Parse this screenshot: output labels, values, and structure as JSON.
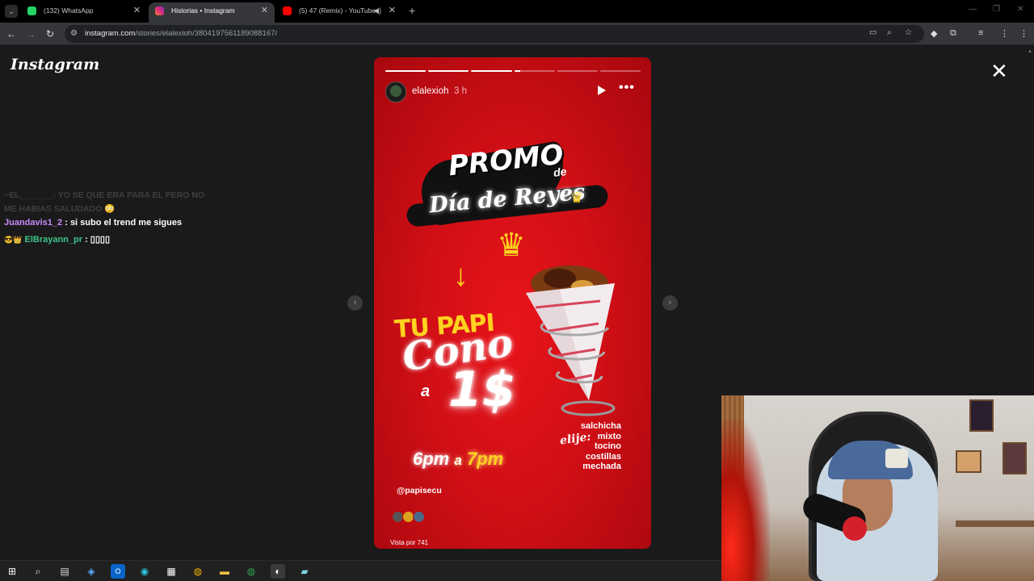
{
  "browser": {
    "tabs": [
      {
        "title": "(132) WhatsApp",
        "favicon_color": "#25d366",
        "active": false
      },
      {
        "title": "Historias • Instagram",
        "favicon_color": "#e1306c",
        "active": true
      },
      {
        "title": "(5) 47 (Remix) - YouTube",
        "favicon_color": "#ff0000",
        "active": false
      }
    ],
    "url_host": "instagram.com",
    "url_path": "/stories/elalexioh/3804197561189088167/"
  },
  "instagram": {
    "logo": "Instagram"
  },
  "chat": {
    "faded_user": "~EL_______",
    "faded_msg": ": YO SE QUE ERA PARA EL PERO NO ME HABIAS SALUDADO 😳",
    "line1_user": "Juandavis1_2",
    "line1_msg": ": si subo el trend me sigues",
    "line2_user": "ElBrayann_pr",
    "line2_msg": ": ▯▯▯▯"
  },
  "story": {
    "username": "elalexioh",
    "time": "3 h",
    "progress": [
      1,
      1,
      1,
      0.15,
      0,
      0
    ],
    "promo_title": "PROMO",
    "promo_de": "de",
    "promo_sub": "Día de Reyes",
    "tu_papi": "TU PAPI",
    "cono": "Cono",
    "price_a": "a",
    "price": "1$",
    "elije": "elije:",
    "options": [
      "salchicha",
      "mixto",
      "tocino",
      "costillas",
      "mechada"
    ],
    "hour_start": "6pm",
    "hour_mid": "a",
    "hour_end": "7pm",
    "handle": "@papisecu",
    "views": "Vista por 741"
  },
  "colors": {
    "story_red": "#d10f16",
    "accent_yellow": "#ffd21f"
  }
}
